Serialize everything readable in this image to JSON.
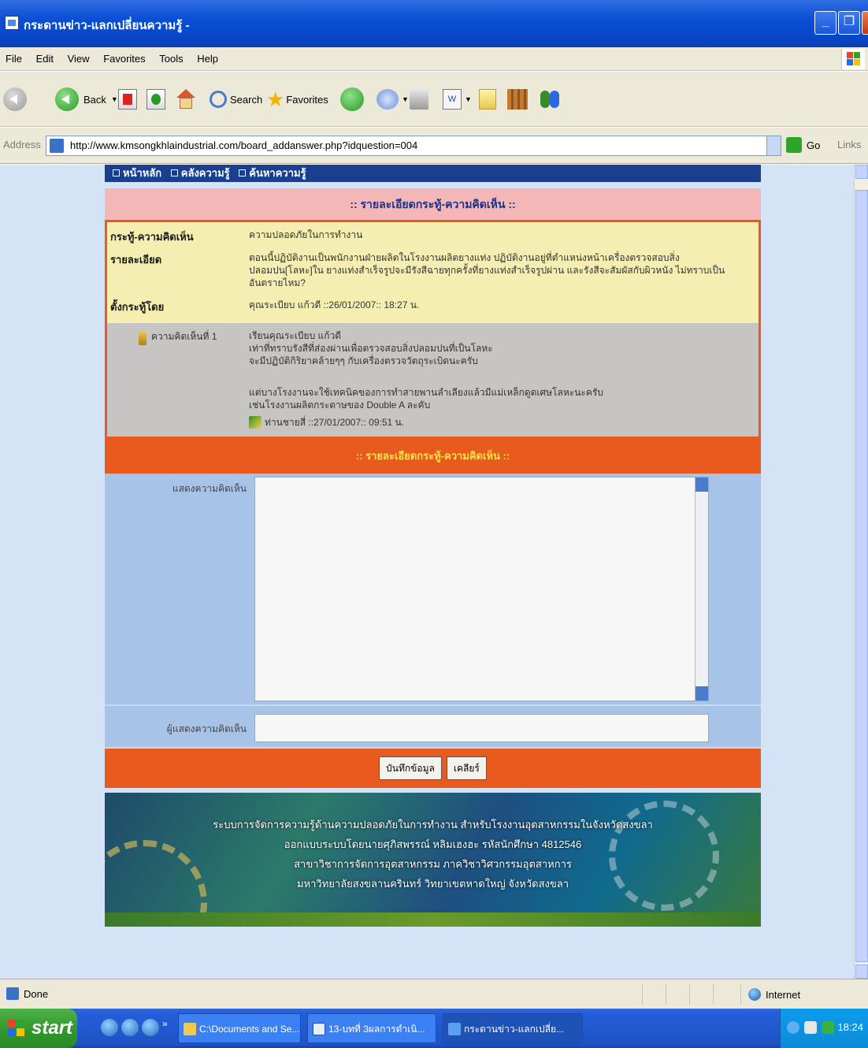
{
  "window": {
    "title": "กระดานข่าว-แลกเปลี่ยนความรู้ -",
    "controls": [
      "minimize",
      "restore",
      "close"
    ]
  },
  "menu": [
    "File",
    "Edit",
    "View",
    "Favorites",
    "Tools",
    "Help"
  ],
  "toolbar": {
    "back_label": "Back",
    "search_label": "Search",
    "favorites_label": "Favorites"
  },
  "address": {
    "label": "Address",
    "url": "http://www.kmsongkhlaindustrial.com/board_addanswer.php?idquestion=004",
    "go_label": "Go",
    "links_label": "Links"
  },
  "page": {
    "nav": [
      "หน้าหลัก",
      "คลังความรู้",
      "ค้นหาความรู้"
    ],
    "detail_header": ":: รายละเอียดกระทู้-ความคิดเห็น ::",
    "topic_key": "กระทู้-ความคิดเห็น",
    "topic_value": "ความปลอดภัยในการทำงาน",
    "detail_key": "รายละเอียด",
    "detail_value": "ตอนนี้ปฏิบัติงานเป็นพนักงานฝ่ายผลิตในโรงงานผลิตยางแท่ง ปฏิบัติงานอยู่ที่ตำแหน่งหน้าเครื่องตรวจสอบสิ่งปลอมปน[โลหะ]ใน ยางแท่งสำเร็จรูปจะมีรังสีฉายทุกครั้งที่ยางแท่งสำเร็จรูปผ่าน และรังสีจะสัมผัสกับผิวหนัง ไม่ทราบเป็นอันตรายไหม?",
    "poster_key": "ตั้งกระทู้โดย",
    "poster_value": "คุณระเบียบ แก้วดี ::26/01/2007:: 18:27 น.",
    "reply_label": "ความคิดเห็นที่ 1",
    "reply_lines": [
      "เรียนคุณระเบียบ แก้วดี",
      "เท่าที่ทราบรังสีที่ส่องผ่านเพื่อตรวจสอบสิ่งปลอมปนที่เป็นโลหะ",
      "จะมีปฏิบัติกิริยาคล้ายๆๆ กับเครื่องตรวจวัตถุระเบิดนะครับ",
      "",
      "แต่บางโรงงานจะใช้เทคนิคของการทำสายพานลำเลียงแล้วมีแม่เหล็กดูดเศษโลหะนะครับ",
      "เช่นโรงงานผลิตกระดาษของ Double A ละคับ"
    ],
    "reply_by": "ท่านชายสี่ ::27/01/2007:: 09:51 น.",
    "form_header": ":: รายละเอียดกระทู้-ความคิดเห็น ::",
    "comment_label": "แสดงความคิดเห็น",
    "commenter_label": "ผู้แสดงความคิดเห็น",
    "save_button": "บันทึกข้อมูล",
    "clear_button": "เคลียร์",
    "banner_lines": [
      "ระบบการจัดการความรู้ด้านความปลอดภัยในการทำงาน สำหรับโรงงานอุตสาหกรรมในจังหวัดสงขลา",
      "ออกแบบระบบโดยนายศุภิสพรรณ์ หลิมเฮงฮะ รหัสนักศึกษา 4812546",
      "สาขาวิชาการจัดการอุตสาหกรรม ภาควิชาวิศวกรรมอุตสาหการ",
      "มหาวิทยาลัยสงขลานครินทร์ วิทยาเขตหาดใหญ่ จังหวัดสงขลา"
    ]
  },
  "status": {
    "text": "Done",
    "zone": "Internet"
  },
  "taskbar": {
    "start_label": "start",
    "tasks": [
      "C:\\Documents and Se...",
      "13-บทที่ 3ผลการดำเนิ...",
      "กระดานข่าว-แลกเปลี่ย..."
    ],
    "clock": "18:24"
  },
  "colors": {
    "nav": "#1a3f8e",
    "pink_header": "#f3b7b7",
    "orange": "#e85a1e",
    "detail_bg": "#f4efb0",
    "form_bg": "#a8c3e8"
  }
}
